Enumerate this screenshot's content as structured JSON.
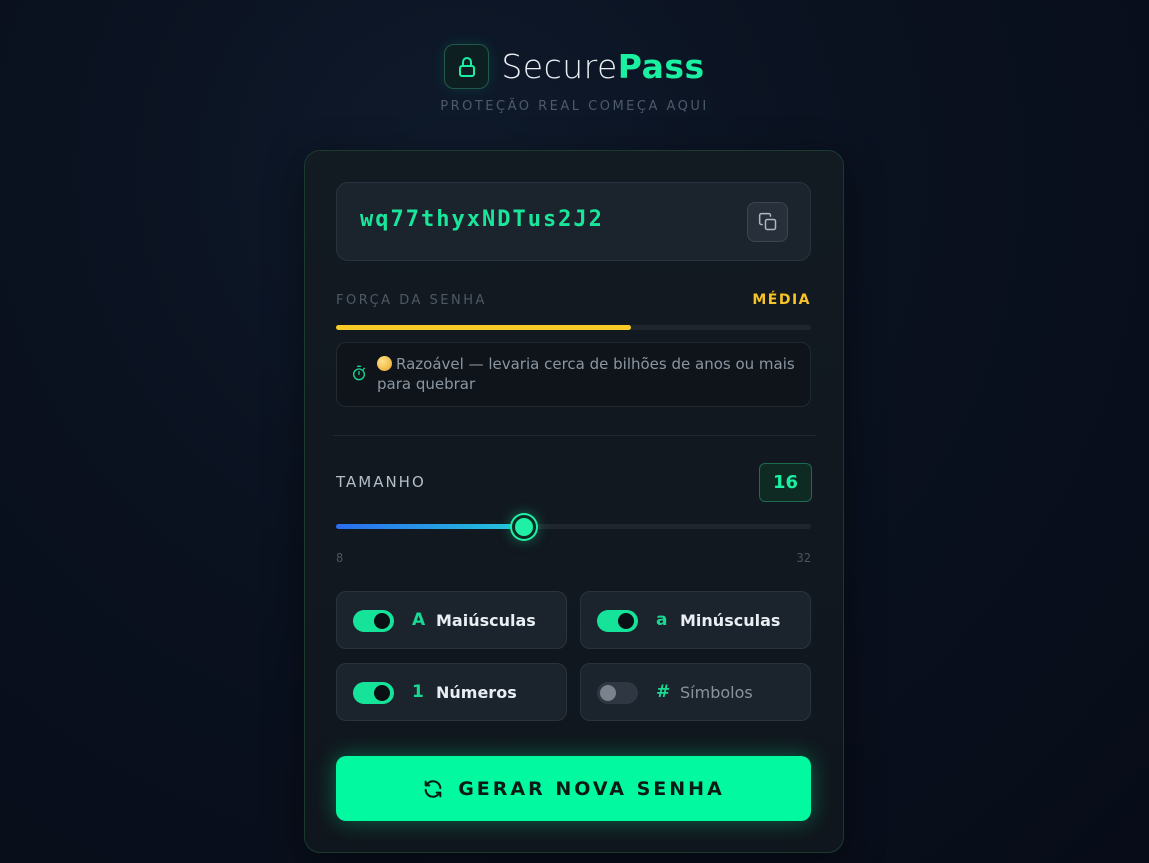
{
  "header": {
    "brand_part1": "Secure",
    "brand_part2": "Pass",
    "tagline": "PROTEÇÃO REAL COMEÇA AQUI",
    "logo_icon": "lock-icon"
  },
  "password": {
    "value": "wq77thyxNDTus2J2",
    "copy_icon": "copy-icon"
  },
  "strength": {
    "label": "FORÇA DA SENHA",
    "value": "MÉDIA",
    "level": 0.62,
    "color": "#f7cb28",
    "estimate_icon": "stopwatch-icon",
    "estimate_text": "Razoável — levaria cerca de bilhões de anos ou mais para quebrar"
  },
  "size": {
    "label": "TAMANHO",
    "value": "16",
    "current": 16,
    "min": 8,
    "max": 32,
    "min_label": "8",
    "max_label": "32"
  },
  "options": [
    {
      "glyph": "A",
      "label": "Maiúsculas",
      "enabled": true
    },
    {
      "glyph": "a",
      "label": "Minúsculas",
      "enabled": true
    },
    {
      "glyph": "1",
      "label": "Números",
      "enabled": true
    },
    {
      "glyph": "#",
      "label": "Símbolos",
      "enabled": false
    }
  ],
  "generate": {
    "label": "GERAR NOVA SENHA",
    "icon": "refresh-icon"
  },
  "colors": {
    "accent": "#19f0a2",
    "strength_medium": "#f7c325",
    "background": "#0a111f"
  }
}
